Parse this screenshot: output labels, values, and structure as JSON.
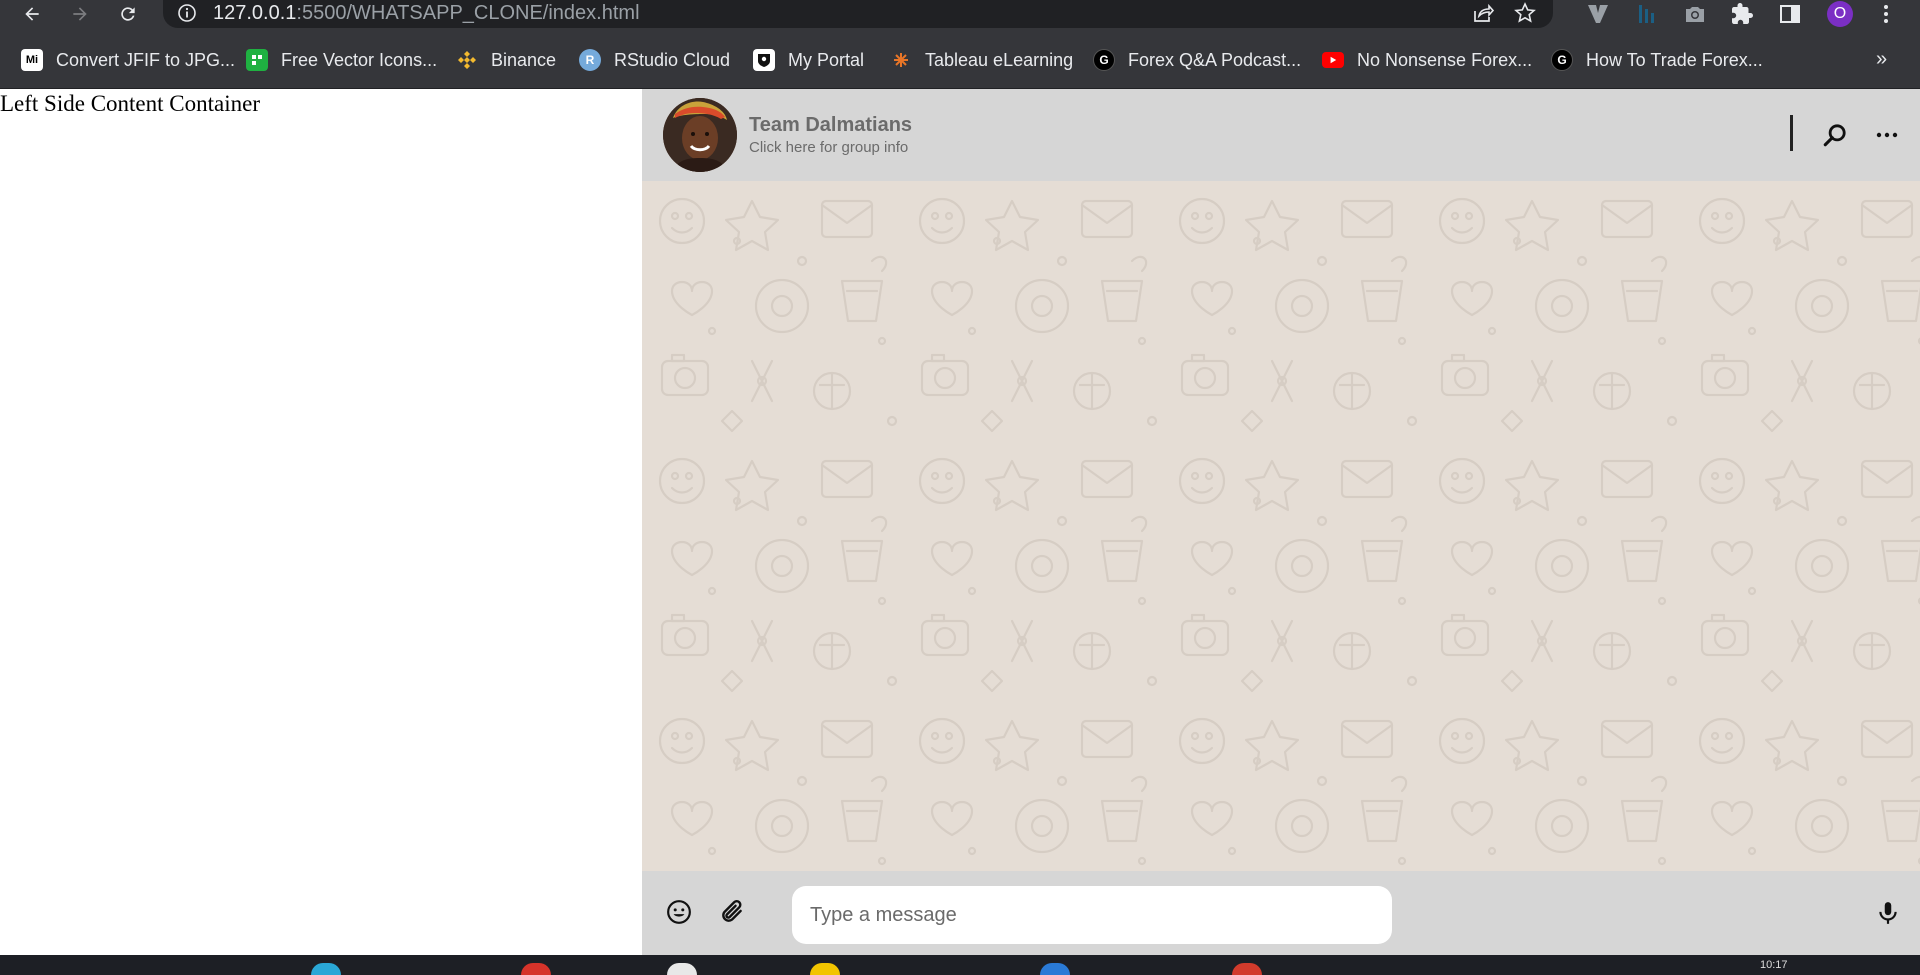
{
  "browser": {
    "url_host": "127.0.0.1",
    "url_path": ":5500/WHATSAPP_CLONE/index.html",
    "profile_initial": "O"
  },
  "bookmarks": [
    {
      "label": "Convert JFIF to JPG...",
      "icon": "mi-favicon",
      "color": "#ffffff"
    },
    {
      "label": "Free Vector Icons...",
      "icon": "flaticon-favicon",
      "color": "#1fb141"
    },
    {
      "label": "Binance",
      "icon": "binance-favicon",
      "color": "#f3ba2f"
    },
    {
      "label": "RStudio Cloud",
      "icon": "rstudio-favicon",
      "color": "#75aadb"
    },
    {
      "label": "My Portal",
      "icon": "portal-favicon",
      "color": "#ffffff"
    },
    {
      "label": "Tableau eLearning",
      "icon": "tableau-favicon",
      "color": "#e97627"
    },
    {
      "label": "Forex Q&A Podcast...",
      "icon": "g-favicon",
      "color": "#000000"
    },
    {
      "label": "No Nonsense Forex...",
      "icon": "youtube-favicon",
      "color": "#ff0000"
    },
    {
      "label": "How To Trade Forex...",
      "icon": "g-favicon",
      "color": "#000000"
    }
  ],
  "left_panel": {
    "text": "Left Side Content Container"
  },
  "chat": {
    "group_name": "Team Dalmatians",
    "group_subtitle": "Click here for group info",
    "message_placeholder": "Type a message",
    "background_color": "#e5ddd5",
    "header_color": "#d6d6d6"
  },
  "taskbar": {
    "time": "10:17"
  }
}
